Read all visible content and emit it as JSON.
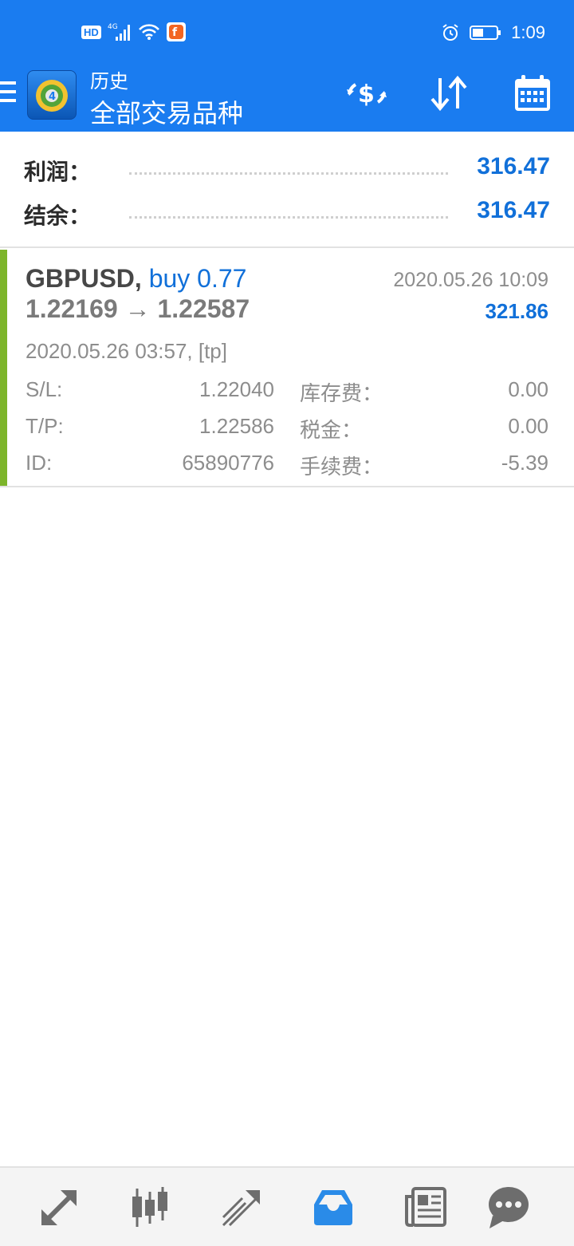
{
  "status_bar": {
    "network": "HD",
    "signal": "4G",
    "time": "1:09"
  },
  "header": {
    "title": "历史",
    "subtitle": "全部交易品种"
  },
  "toolbar": {
    "icons": [
      "currency-exchange-icon",
      "sort-icon",
      "calendar-icon"
    ]
  },
  "summary": [
    {
      "label": "利润：",
      "value": "316.47"
    },
    {
      "label": "结余：",
      "value": "316.47"
    }
  ],
  "trade": {
    "symbol": "GBPUSD,",
    "side": "buy 0.77",
    "prices": "1.22169 → 1.22587",
    "close_time": "2020.05.26 10:09",
    "profit": "321.86",
    "open_time": "2020.05.26 03:57, [tp]",
    "sl_label": "S/L:",
    "sl_value": "1.22040",
    "tp_label": "T/P:",
    "tp_value": "1.22586",
    "id_label": "ID:",
    "id_value": "65890776",
    "swap_label": "库存费：",
    "swap_value": "0.00",
    "tax_label": "税金：",
    "tax_value": "0.00",
    "commission_label": "手续费：",
    "commission_value": "-5.39"
  },
  "colors": {
    "brand": "#1a7cf0",
    "value_blue": "#1170d9",
    "accent_green": "#7db52b",
    "active_nav": "#2a8be8"
  },
  "bottom_nav": {
    "items": [
      "quotes-icon",
      "chart-icon",
      "trade-icon",
      "history-icon",
      "news-icon",
      "chat-icon"
    ],
    "active": "history-icon"
  }
}
